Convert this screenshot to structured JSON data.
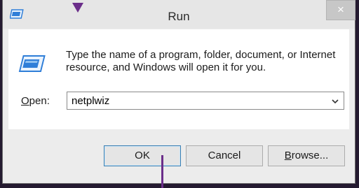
{
  "window": {
    "title": "Run",
    "close_glyph": "×"
  },
  "icons": {
    "title_icon": "run-icon",
    "main_icon": "run-icon",
    "close_icon": "close-icon",
    "dropdown_icon": "chevron-down-icon"
  },
  "description": "Type the name of a program, folder, document, or Internet resource, and Windows will open it for you.",
  "open_field": {
    "label_underlined": "O",
    "label_rest": "pen:",
    "value": "netplwiz"
  },
  "buttons": {
    "ok": "OK",
    "cancel": "Cancel",
    "browse_underlined": "B",
    "browse_rest": "rowse..."
  },
  "colors": {
    "desktop": "#241a30",
    "annotation": "#6b2e8a",
    "accent_icon": "#2f7ed8"
  }
}
